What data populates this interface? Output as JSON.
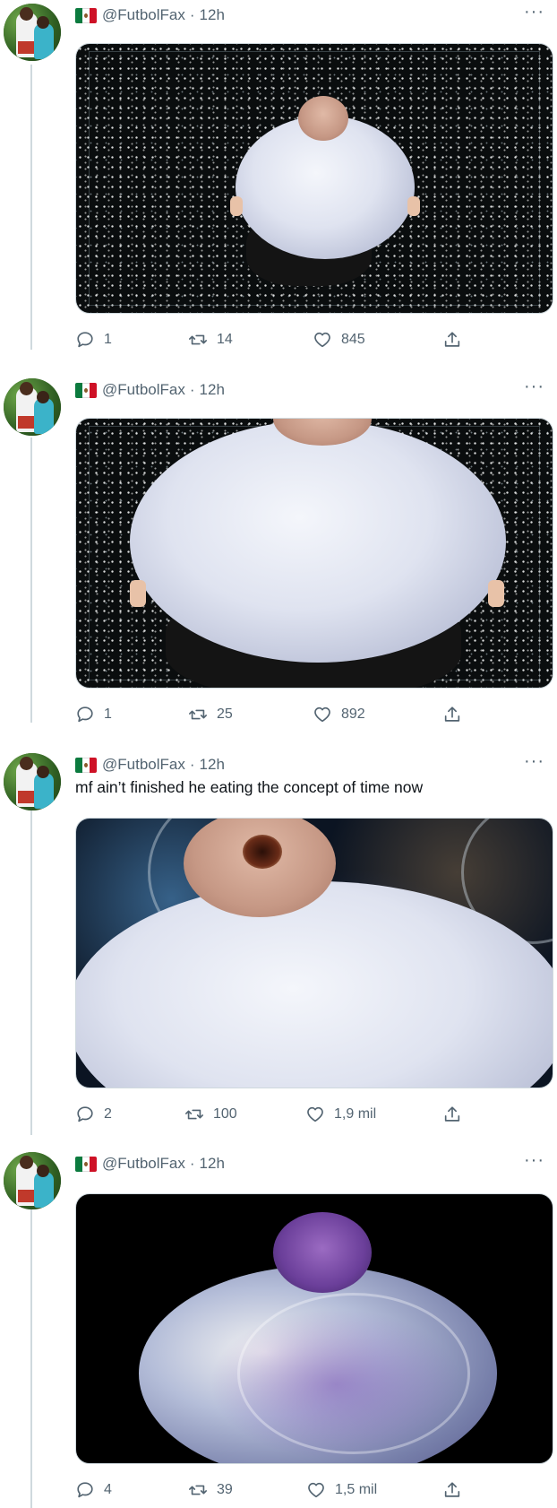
{
  "tweets": [
    {
      "handle": "@FutbolFax",
      "time": "12h",
      "text": "",
      "replies": "1",
      "retweets": "14",
      "likes": "845"
    },
    {
      "handle": "@FutbolFax",
      "time": "12h",
      "text": "",
      "replies": "1",
      "retweets": "25",
      "likes": "892"
    },
    {
      "handle": "@FutbolFax",
      "time": "12h",
      "text": "mf ain’t finished he eating the concept of time now",
      "replies": "2",
      "retweets": "100",
      "likes": "1,9 mil"
    },
    {
      "handle": "@FutbolFax",
      "time": "12h",
      "text": "",
      "replies": "4",
      "retweets": "39",
      "likes": "1,5 mil"
    }
  ],
  "icons": {
    "reply": "reply-icon",
    "retweet": "retweet-icon",
    "like": "heart-icon",
    "share": "share-icon",
    "more": "more-icon",
    "flag": "mexico-flag-icon"
  },
  "colors": {
    "secondary_text": "#536471",
    "thread_line": "#cfd9de"
  }
}
